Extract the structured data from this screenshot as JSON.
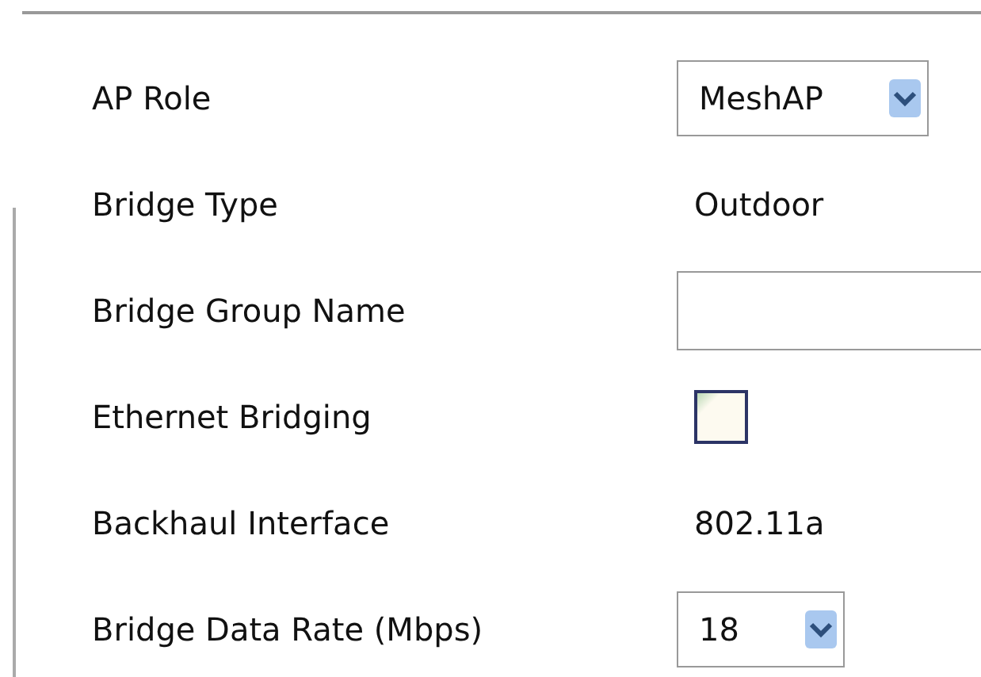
{
  "rows": [
    {
      "label": "AP Role",
      "kind": "select",
      "value": "MeshAP"
    },
    {
      "label": "Bridge Type",
      "kind": "text",
      "value": "Outdoor"
    },
    {
      "label": "Bridge Group Name",
      "kind": "input"
    },
    {
      "label": "Ethernet Bridging",
      "kind": "checkbox",
      "checked": false
    },
    {
      "label": "Backhaul Interface",
      "kind": "text",
      "value": "802.11a"
    },
    {
      "label": "Bridge Data Rate (Mbps)",
      "kind": "select",
      "value": "18"
    }
  ]
}
